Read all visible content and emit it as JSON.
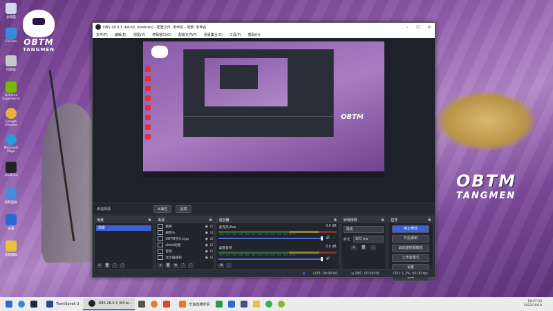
{
  "desktop": {
    "icons": [
      {
        "label": "此电脑",
        "color": "#cfd8e6"
      },
      {
        "label": "EVCam",
        "color": "#3a8ad8"
      },
      {
        "label": "回收站",
        "color": "#c9c9c9"
      },
      {
        "label": "GeForce Experience",
        "color": "#76b900"
      },
      {
        "label": "Google Chrome",
        "color": "#e8b23a"
      },
      {
        "label": "Microsoft Edge",
        "color": "#2a9ad8"
      },
      {
        "label": "cmdLine",
        "color": "#222222"
      },
      {
        "label": "控制面板",
        "color": "#4a8ad8"
      },
      {
        "label": "设置",
        "color": "#2a6ad8"
      },
      {
        "label": "电脑编辑",
        "color": "#e8c23a"
      }
    ],
    "logo_left": {
      "title": "OBTM",
      "subtitle": "TANGMEN"
    },
    "logo_right": {
      "title": "OBTM",
      "subtitle": "TANGMEN"
    },
    "clock": {
      "time": "18:47:33",
      "date": "2022/10/10"
    }
  },
  "obs": {
    "title": "OBS 28.0.3 (64-bit, windows) - 配置文件: 未命名 - 场景: 未命名",
    "window_buttons": [
      "–",
      "☐",
      "✕"
    ],
    "menu": [
      "文件(F)",
      "编辑(E)",
      "视图(V)",
      "停靠窗口(D)",
      "配置文件(P)",
      "场景集合(S)",
      "工具(T)",
      "帮助(H)"
    ],
    "canvas_logo": "OBTM",
    "context_bar": {
      "label": "未选择源",
      "properties": "⚙属性",
      "filters": "滤镜"
    },
    "scenes": {
      "title": "场景",
      "items": [
        "场景"
      ]
    },
    "sources": {
      "title": "来源",
      "items": [
        {
          "name": "截屏"
        },
        {
          "name": "摄像头"
        },
        {
          "name": "OBTM顶头logo"
        },
        {
          "name": "obtm动图"
        },
        {
          "name": "音频"
        },
        {
          "name": "显示器捕获"
        }
      ]
    },
    "mixer": {
      "title": "混音器",
      "channels": [
        {
          "name": "麦克风/Aux",
          "db": "0.0 dB"
        },
        {
          "name": "桌面音频",
          "db": "0.0 dB"
        }
      ],
      "scale": "-60 -55 -50 -45 -40 -35 -30 -25 -20 -15 -10 -5 0"
    },
    "transitions": {
      "title": "转场特效",
      "selected": "渐变",
      "duration_label": "时长",
      "duration": "300 ms"
    },
    "controls": {
      "title": "控件",
      "buttons": [
        "停止推流",
        "开始录制",
        "启动虚拟摄像机",
        "工作室模式",
        "设置",
        "退出"
      ]
    },
    "status": {
      "live": "LIVE: 00:00:00",
      "rec": "REC: 00:00:00",
      "cpu": "CPU: 1.2%, 60.00 fps"
    }
  },
  "taskbar": {
    "apps": [
      {
        "label": "TeamSpeak 3",
        "color": "#2a4a8a"
      },
      {
        "label": "OBS 28.0.3 (64-bi...",
        "color": "#222222"
      },
      {
        "label": "乐鱼直播伴侣",
        "color": "#e87a2a"
      }
    ]
  }
}
